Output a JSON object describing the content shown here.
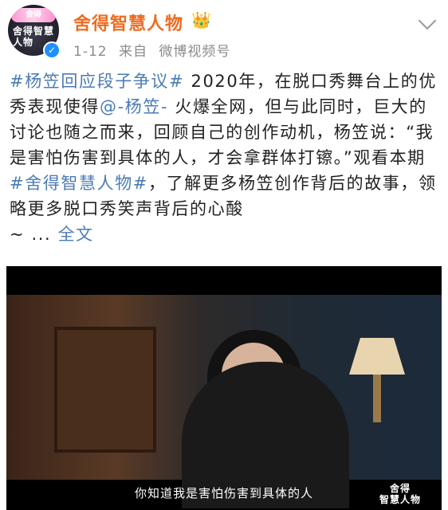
{
  "header": {
    "avatar_top_text": "舍得",
    "avatar_main_text": "舍得智慧人物",
    "username": "舍得智慧人物",
    "date": "1-12",
    "from_label": "来自",
    "source": "微博视频号"
  },
  "post": {
    "tag1": "#杨笠回应段子争议#",
    "text1": " 2020年，在脱口秀舞台上的优秀表现使得",
    "mention": "@-杨笠-",
    "text2": " 火爆全网，但与此同时，巨大的讨论也随之而来，回顾自己的创作动机，杨笠说：“我是害怕伤害到具体的人，才会拿群体打镲。”观看本期 ",
    "tag2": "#舍得智慧人物#",
    "text3": "，了解更多杨笠创作背后的故事，领略更多脱口秀笑声背后的心酸",
    "ellipsis": "~ ...",
    "fulltext": "全文"
  },
  "video": {
    "subtitle": "你知道我是害怕伤害到具体的人",
    "logo_top": "舍得",
    "logo_bottom": "智慧人物"
  },
  "colors": {
    "username": "#f06b1e",
    "link": "#4b7bb5",
    "meta": "#8b8b8b",
    "verified": "#1e90ff"
  }
}
